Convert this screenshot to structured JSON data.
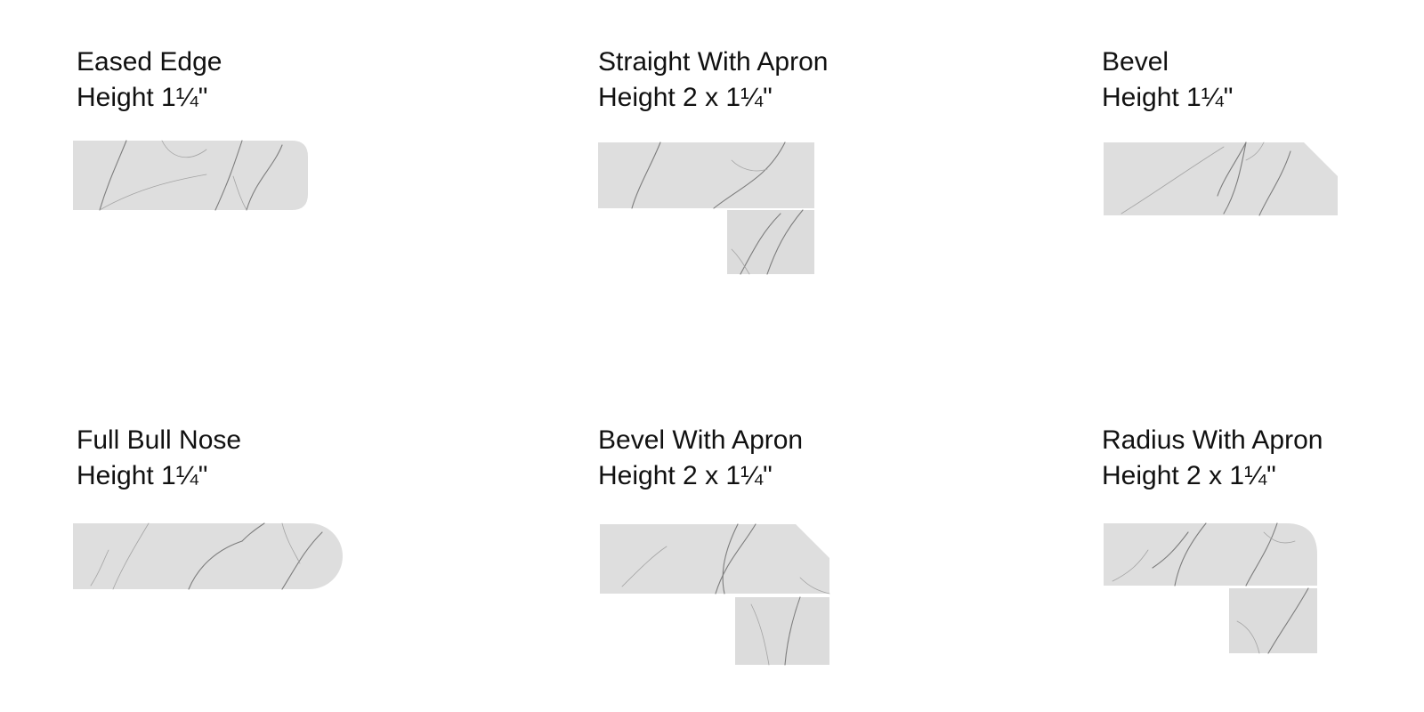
{
  "profiles": [
    {
      "name": "Eased Edge",
      "height": "Height 1¼\"",
      "shape": "eased"
    },
    {
      "name": "Straight With Apron",
      "height": "Height 2 x 1¼\"",
      "shape": "straight-apron"
    },
    {
      "name": "Bevel",
      "height": "Height 1¼\"",
      "shape": "bevel"
    },
    {
      "name": "Full Bull Nose",
      "height": "Height 1¼\"",
      "shape": "full-bull-nose"
    },
    {
      "name": "Bevel With Apron",
      "height": "Height 2 x 1¼\"",
      "shape": "bevel-apron"
    },
    {
      "name": "Radius With Apron",
      "height": "Height 2 x 1¼\"",
      "shape": "radius-apron"
    }
  ],
  "colors": {
    "text": "#111111",
    "stone": "#dedede",
    "vein": "#7d7d7d",
    "background": "#ffffff"
  }
}
